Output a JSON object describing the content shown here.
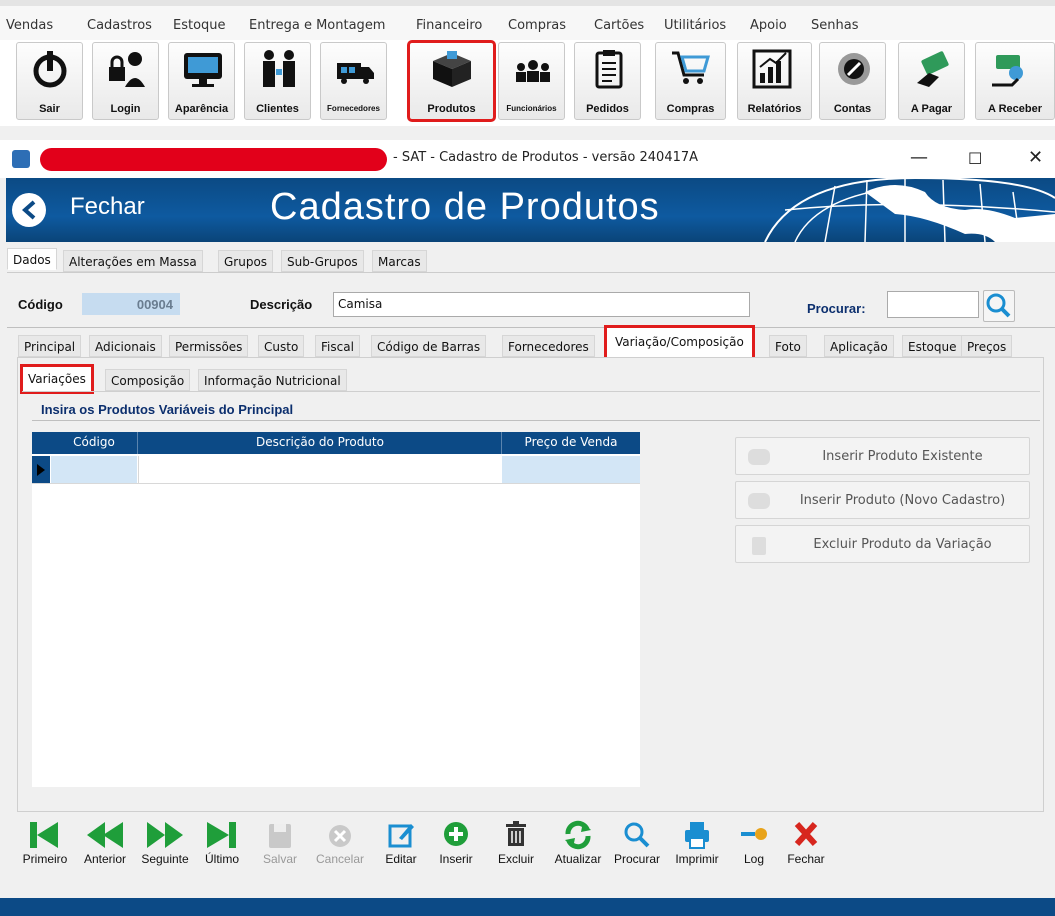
{
  "menu": [
    "Vendas",
    "Cadastros",
    "Estoque",
    "Entrega e Montagem",
    "Financeiro",
    "Compras",
    "Cartões",
    "Utilitários",
    "Apoio",
    "Senhas"
  ],
  "toolbar": [
    {
      "label": "Sair",
      "icon": "power-icon"
    },
    {
      "label": "Login",
      "icon": "login-lock-icon"
    },
    {
      "label": "Aparência",
      "icon": "monitor-icon"
    },
    {
      "label": "Clientes",
      "icon": "clients-icon"
    },
    {
      "label": "Fornecedores",
      "icon": "truck-icon"
    },
    {
      "label": "Produtos",
      "icon": "box-icon"
    },
    {
      "label": "Funcionários",
      "icon": "employees-icon"
    },
    {
      "label": "Pedidos",
      "icon": "clipboard-icon"
    },
    {
      "label": "Compras",
      "icon": "cart-icon"
    },
    {
      "label": "Relatórios",
      "icon": "chart-icon"
    },
    {
      "label": "Contas",
      "icon": "accounts-icon"
    },
    {
      "label": "A Pagar",
      "icon": "pay-icon"
    },
    {
      "label": "A Receber",
      "icon": "receive-icon"
    }
  ],
  "window": {
    "title": "- SAT - Cadastro de Produtos - versão 240417A",
    "back_label": "Fechar",
    "header_title": "Cadastro de Produtos"
  },
  "top_tabs": [
    "Dados",
    "Alterações em Massa",
    "Grupos",
    "Sub-Grupos",
    "Marcas"
  ],
  "form": {
    "codigo_label": "Código",
    "codigo_value": "00904",
    "descricao_label": "Descrição",
    "descricao_value": "Camisa",
    "procurar_label": "Procurar:"
  },
  "detail_tabs": [
    "Principal",
    "Adicionais",
    "Permissões",
    "Custo",
    "Fiscal",
    "Código de Barras",
    "Fornecedores",
    "Variação/Composição",
    "Foto",
    "Aplicação",
    "Estoque",
    "Preços"
  ],
  "sub_tabs": [
    "Variações",
    "Composição",
    "Informação Nutricional"
  ],
  "section_title": "Insira os Produtos Variáveis do Principal",
  "grid": {
    "columns": [
      "Código",
      "Descrição do Produto",
      "Preço de Venda"
    ]
  },
  "side_buttons": [
    "Inserir Produto Existente",
    "Inserir Produto (Novo Cadastro)",
    "Excluir Produto da Variação"
  ],
  "nav": [
    {
      "label": "Primeiro",
      "icon": "first-icon",
      "enabled": true
    },
    {
      "label": "Anterior",
      "icon": "previous-icon",
      "enabled": true
    },
    {
      "label": "Seguinte",
      "icon": "next-icon",
      "enabled": true
    },
    {
      "label": "Último",
      "icon": "last-icon",
      "enabled": true
    },
    {
      "label": "Salvar",
      "icon": "save-icon",
      "enabled": false
    },
    {
      "label": "Cancelar",
      "icon": "cancel-icon",
      "enabled": false
    },
    {
      "label": "Editar",
      "icon": "edit-icon",
      "enabled": true
    },
    {
      "label": "Inserir",
      "icon": "plus-icon",
      "enabled": true
    },
    {
      "label": "Excluir",
      "icon": "trash-icon",
      "enabled": true
    },
    {
      "label": "Atualizar",
      "icon": "refresh-icon",
      "enabled": true
    },
    {
      "label": "Procurar",
      "icon": "search-icon",
      "enabled": true
    },
    {
      "label": "Imprimir",
      "icon": "printer-icon",
      "enabled": true
    },
    {
      "label": "Log",
      "icon": "key-icon",
      "enabled": true
    },
    {
      "label": "Fechar",
      "icon": "close-icon",
      "enabled": true
    }
  ],
  "colors": {
    "brand_blue": "#0c4a86",
    "highlight_red": "#e01c1c",
    "nav_green": "#1f9e3a"
  }
}
